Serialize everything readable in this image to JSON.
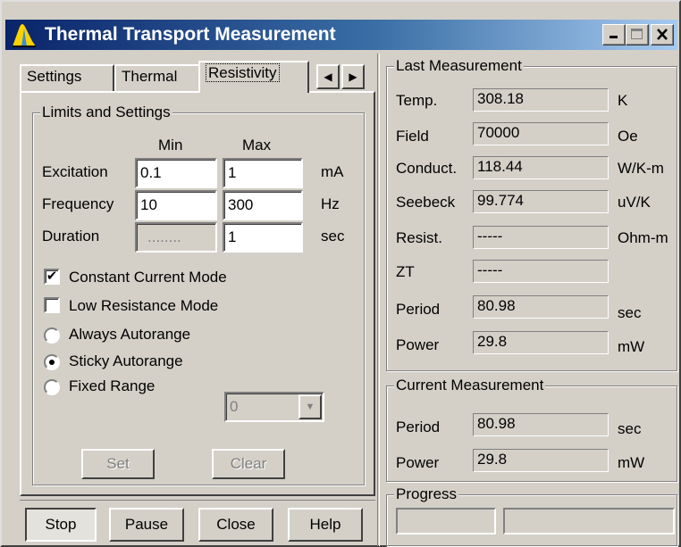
{
  "window": {
    "title": "Thermal Transport Measurement",
    "caption_buttons": {
      "minimize": "_",
      "maximize": "□",
      "close": "X"
    }
  },
  "tabs": [
    {
      "label": "Settings"
    },
    {
      "label": "Thermal"
    },
    {
      "label": "Resistivity"
    }
  ],
  "tab_scroll": {
    "left": "◀",
    "right": "▶"
  },
  "limits": {
    "legend": "Limits and Settings",
    "col_min": "Min",
    "col_max": "Max",
    "rows": [
      {
        "label": "Excitation",
        "min": "0.1",
        "max": "1",
        "unit": "mA"
      },
      {
        "label": "Frequency",
        "min": "10",
        "max": "300",
        "unit": "Hz"
      },
      {
        "label": "Duration",
        "min": "........",
        "max": "1",
        "unit": "sec"
      }
    ],
    "checkboxes": [
      {
        "label": "Constant Current Mode",
        "checked": true,
        "mark": "✔"
      },
      {
        "label": "Low Resistance Mode",
        "checked": false,
        "mark": ""
      }
    ],
    "radios": [
      {
        "label": "Always Autorange",
        "selected": false
      },
      {
        "label": "Sticky Autorange",
        "selected": true
      },
      {
        "label": "Fixed Range",
        "selected": false
      }
    ],
    "range_select": {
      "value": "0",
      "arrow": "▼"
    },
    "set_label": "Set",
    "clear_label": "Clear"
  },
  "buttons": {
    "stop": "Stop",
    "pause": "Pause",
    "close": "Close",
    "help": "Help"
  },
  "last_measurement": {
    "legend": "Last Measurement",
    "rows": [
      {
        "label": "Temp.",
        "value": "308.18",
        "unit": "K"
      },
      {
        "label": "Field",
        "value": "70000",
        "unit": "Oe"
      },
      {
        "label": "Conduct.",
        "value": "118.44",
        "unit": "W/K-m"
      },
      {
        "label": "Seebeck",
        "value": "99.774",
        "unit": "uV/K"
      },
      {
        "label": "Resist.",
        "value": "-----",
        "unit": "Ohm-m"
      },
      {
        "label": "ZT",
        "value": "-----",
        "unit": ""
      },
      {
        "label": "Period",
        "value": "80.98",
        "unit": "sec"
      },
      {
        "label": "Power",
        "value": "29.8",
        "unit": "mW"
      }
    ]
  },
  "current_measurement": {
    "legend": "Current Measurement",
    "rows": [
      {
        "label": "Period",
        "value": "80.98",
        "unit": "sec"
      },
      {
        "label": "Power",
        "value": "29.8",
        "unit": "mW"
      }
    ]
  },
  "progress": {
    "legend": "Progress",
    "fraction": 0
  },
  "colors": {
    "title_start": "#0a246a",
    "title_end": "#a6caf0",
    "face": "#d4d0c8"
  }
}
